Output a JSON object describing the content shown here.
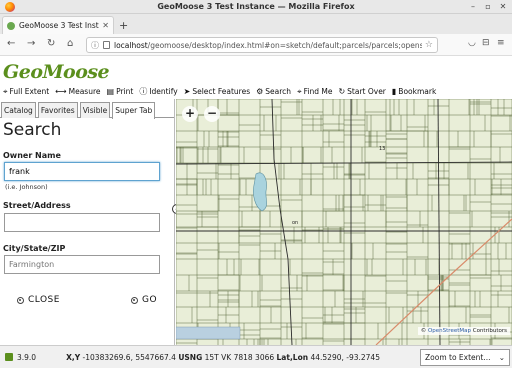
{
  "browser": {
    "window_title": "GeoMoose 3 Test Instance — Mozilla Firefox",
    "tab_title": "GeoMoose 3 Test Instanc",
    "new_tab_glyph": "+",
    "url_host": "localhost",
    "url_path": "/geomoose/desktop/index.html#on=sketch/default;parcels/parcels;openstre"
  },
  "app": {
    "logo_text": "GeoMoose"
  },
  "toolbar": {
    "items": [
      {
        "label": "Full Extent",
        "icon": "map-pin-icon"
      },
      {
        "label": "Measure",
        "icon": "ruler-icon"
      },
      {
        "label": "Print",
        "icon": "printer-icon"
      },
      {
        "label": "Identify",
        "icon": "info-icon"
      },
      {
        "label": "Select Features",
        "icon": "cursor-icon"
      },
      {
        "label": "Search",
        "icon": "gear-icon"
      },
      {
        "label": "Find Me",
        "icon": "location-icon"
      },
      {
        "label": "Start Over",
        "icon": "refresh-icon"
      },
      {
        "label": "Bookmark",
        "icon": "bookmark-icon"
      }
    ]
  },
  "panel": {
    "tabs": [
      "Catalog",
      "Favorites",
      "Visible",
      "Super Tab"
    ],
    "active_tab": "Super Tab",
    "title": "Search",
    "owner_label": "Owner Name",
    "owner_value": "frank",
    "owner_hint": "(i.e. Johnson)",
    "street_label": "Street/Address",
    "street_value": "",
    "city_label": "City/State/ZIP",
    "city_placeholder": "Farmington",
    "close_label": "CLOSE",
    "go_label": "GO"
  },
  "map": {
    "zoom_in": "+",
    "zoom_out": "−",
    "attribution_prefix": "©",
    "attribution_link": "OpenStreetMap",
    "attribution_suffix": "Contributors",
    "label_on": "on",
    "label_13": "13"
  },
  "status": {
    "version": "3.9.0",
    "xy_label": "X,Y",
    "xy_value": "-10383269.6, 5547667.4",
    "usng_label": "USNG",
    "usng_value": "15T VK 7818 3066",
    "latlon_label": "Lat,Lon",
    "latlon_value": "44.5290, -93.2745",
    "zoom_select": "Zoom to Extent..."
  }
}
